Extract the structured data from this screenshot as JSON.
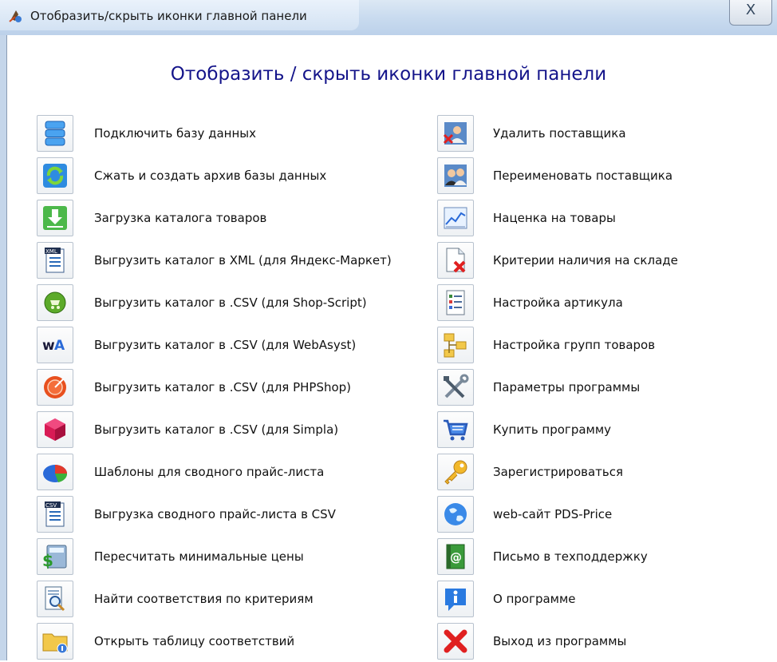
{
  "window": {
    "title": "Отобразить/скрыть иконки главной панели",
    "close_label": "X"
  },
  "heading": "Отобразить / скрыть иконки главной панели",
  "left_column": [
    {
      "label": "Подключить базу данных",
      "icon": "database-icon"
    },
    {
      "label": "Сжать и создать архив базы данных",
      "icon": "refresh-archive-icon"
    },
    {
      "label": "Загрузка каталога товаров",
      "icon": "download-icon"
    },
    {
      "label": "Выгрузить каталог в XML (для Яндекс-Маркет)",
      "icon": "xml-file-icon"
    },
    {
      "label": "Выгрузить каталог в .CSV (для Shop-Script)",
      "icon": "shop-script-icon"
    },
    {
      "label": "Выгрузить каталог в .CSV (для WebAsyst)",
      "icon": "webasyst-icon"
    },
    {
      "label": "Выгрузить каталог в .CSV (для PHPShop)",
      "icon": "phpshop-icon"
    },
    {
      "label": "Выгрузить каталог в .CSV (для Simpla)",
      "icon": "simpla-icon"
    },
    {
      "label": "Шаблоны для сводного прайс-листа",
      "icon": "pie-chart-icon"
    },
    {
      "label": "Выгрузка сводного прайс-листа в CSV",
      "icon": "csv-file-icon"
    },
    {
      "label": "Пересчитать минимальные цены",
      "icon": "calculator-icon"
    },
    {
      "label": "Найти соответствия по критериям",
      "icon": "search-document-icon"
    },
    {
      "label": "Открыть таблицу соответствий",
      "icon": "folder-icon"
    }
  ],
  "right_column": [
    {
      "label": "Удалить поставщика",
      "icon": "delete-user-icon"
    },
    {
      "label": "Переименовать поставщика",
      "icon": "rename-user-icon"
    },
    {
      "label": "Наценка на товары",
      "icon": "chart-icon"
    },
    {
      "label": "Критерии наличия на складе",
      "icon": "document-x-icon"
    },
    {
      "label": "Настройка артикула",
      "icon": "checklist-icon"
    },
    {
      "label": "Настройка групп товаров",
      "icon": "groups-icon"
    },
    {
      "label": "Параметры программы",
      "icon": "tools-icon"
    },
    {
      "label": "Купить программу",
      "icon": "cart-icon"
    },
    {
      "label": "Зарегистрироваться",
      "icon": "key-icon"
    },
    {
      "label": "web-сайт PDS-Price",
      "icon": "globe-icon"
    },
    {
      "label": "Письмо в техподдержку",
      "icon": "email-icon"
    },
    {
      "label": "О программе",
      "icon": "info-icon"
    },
    {
      "label": "Выход из программы",
      "icon": "exit-icon"
    }
  ]
}
